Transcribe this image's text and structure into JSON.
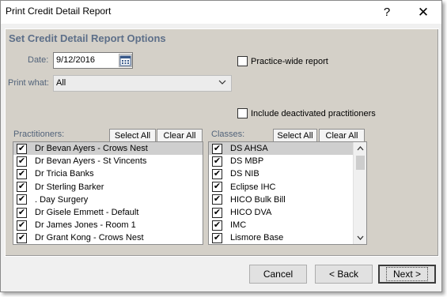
{
  "window": {
    "title": "Print Credit Detail Report",
    "help_glyph": "?",
    "close_glyph": "✕"
  },
  "options": {
    "heading": "Set Credit Detail Report Options",
    "date_label": "Date:",
    "date_value": "9/12/2016",
    "print_what_label": "Print what:",
    "print_what_value": "All",
    "practice_wide_label": "Practice-wide report",
    "practice_wide_checked": false,
    "include_deactivated_label": "Include deactivated practitioners",
    "include_deactivated_checked": false
  },
  "practitioners": {
    "label": "Practitioners:",
    "select_all": "Select All",
    "clear_all": "Clear All",
    "items": [
      {
        "label": "Dr Bevan Ayers - Crows Nest",
        "checked": true,
        "selected": true
      },
      {
        "label": "Dr Bevan Ayers - St Vincents",
        "checked": true,
        "selected": false
      },
      {
        "label": "Dr Tricia Banks",
        "checked": true,
        "selected": false
      },
      {
        "label": "Dr Sterling Barker",
        "checked": true,
        "selected": false
      },
      {
        "label": ". Day Surgery",
        "checked": true,
        "selected": false
      },
      {
        "label": "Dr Gisele Emmett - Default",
        "checked": true,
        "selected": false
      },
      {
        "label": "Dr James Jones - Room 1",
        "checked": true,
        "selected": false
      },
      {
        "label": "Dr Grant Kong - Crows Nest",
        "checked": true,
        "selected": false
      }
    ]
  },
  "classes": {
    "label": "Classes:",
    "select_all": "Select All",
    "clear_all": "Clear All",
    "items": [
      {
        "label": "DS AHSA",
        "checked": true,
        "selected": true
      },
      {
        "label": "DS MBP",
        "checked": true,
        "selected": false
      },
      {
        "label": "DS NIB",
        "checked": true,
        "selected": false
      },
      {
        "label": "Eclipse IHC",
        "checked": true,
        "selected": false
      },
      {
        "label": "HICO Bulk Bill",
        "checked": true,
        "selected": false
      },
      {
        "label": "HICO DVA",
        "checked": true,
        "selected": false
      },
      {
        "label": "IMC",
        "checked": true,
        "selected": false
      },
      {
        "label": "Lismore Base",
        "checked": true,
        "selected": false
      }
    ]
  },
  "footer": {
    "cancel": "Cancel",
    "back": "< Back",
    "next": "Next >"
  },
  "check_glyph": "✔"
}
